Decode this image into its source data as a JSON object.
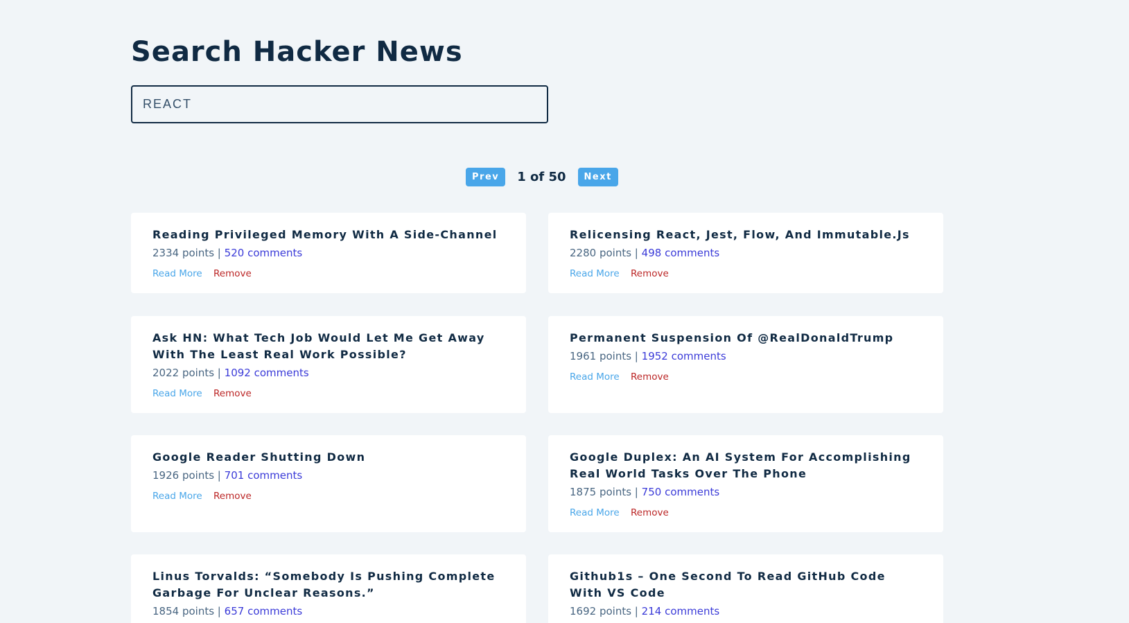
{
  "header": {
    "title": "Search Hacker News"
  },
  "search": {
    "value": "REACT"
  },
  "pagination": {
    "prev_label": "Prev",
    "next_label": "Next",
    "page_info": "1 of 50"
  },
  "story_labels": {
    "points_suffix": "points |",
    "comments_suffix": "comments",
    "read_more": "Read More",
    "remove": "Remove"
  },
  "stories": [
    {
      "title": "Reading Privileged Memory With A Side-Channel",
      "points": "2334",
      "comments": "520"
    },
    {
      "title": "Relicensing React, Jest, Flow, And Immutable.Js",
      "points": "2280",
      "comments": "498"
    },
    {
      "title": "Ask HN: What Tech Job Would Let Me Get Away With The Least Real Work Possible?",
      "points": "2022",
      "comments": "1092"
    },
    {
      "title": "Permanent Suspension Of @RealDonaldTrump",
      "points": "1961",
      "comments": "1952"
    },
    {
      "title": "Google Reader Shutting Down",
      "points": "1926",
      "comments": "701"
    },
    {
      "title": "Google Duplex: An AI System For Accomplishing Real World Tasks Over The Phone",
      "points": "1875",
      "comments": "750"
    },
    {
      "title": "Linus Torvalds: “Somebody Is Pushing Complete Garbage For Unclear Reasons.”",
      "points": "1854",
      "comments": "657"
    },
    {
      "title": "Github1s – One Second To Read GitHub Code With VS Code",
      "points": "1692",
      "comments": "214"
    }
  ],
  "colors": {
    "background": "#f1f5f8",
    "primary": "#102a43",
    "accent": "#49a6e9",
    "comments_link": "#3a3ad8",
    "remove": "#bb2525"
  }
}
